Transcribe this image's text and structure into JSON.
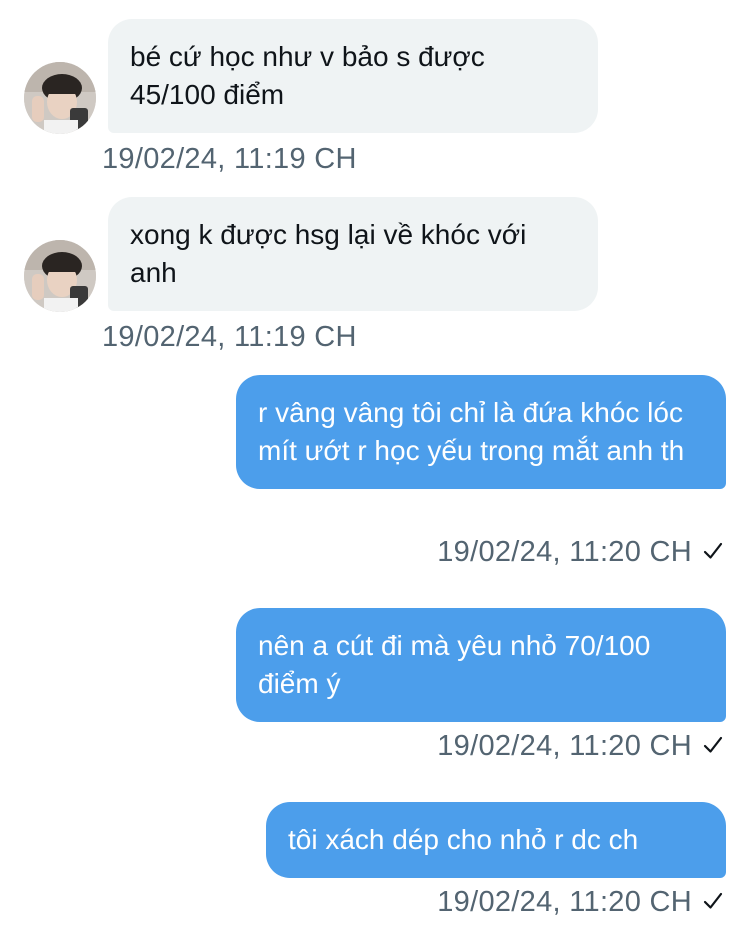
{
  "messages": [
    {
      "direction": "incoming",
      "text": "bé cứ học như v bảo s được 45/100 điểm",
      "timestamp": "19/02/24, 11:19 CH"
    },
    {
      "direction": "incoming",
      "text": "xong k được hsg lại về khóc với anh",
      "timestamp": "19/02/24, 11:19 CH"
    },
    {
      "direction": "outgoing",
      "text": "r vâng vâng tôi chỉ là đứa khóc lóc mít ướt r học yếu trong mắt anh th",
      "timestamp": "19/02/24, 11:20 CH",
      "status_icon": "checkmark-icon"
    },
    {
      "direction": "outgoing",
      "text": "nên a cút đi mà yêu nhỏ 70/100 điểm ý",
      "timestamp": "19/02/24, 11:20 CH",
      "status_icon": "checkmark-icon"
    },
    {
      "direction": "outgoing",
      "text": "tôi xách dép cho nhỏ r dc ch",
      "timestamp": "19/02/24, 11:20 CH",
      "status_icon": "checkmark-icon"
    }
  ],
  "colors": {
    "incoming_bubble": "#eff3f4",
    "outgoing_bubble": "#4c9eeb",
    "timestamp": "#536471"
  }
}
